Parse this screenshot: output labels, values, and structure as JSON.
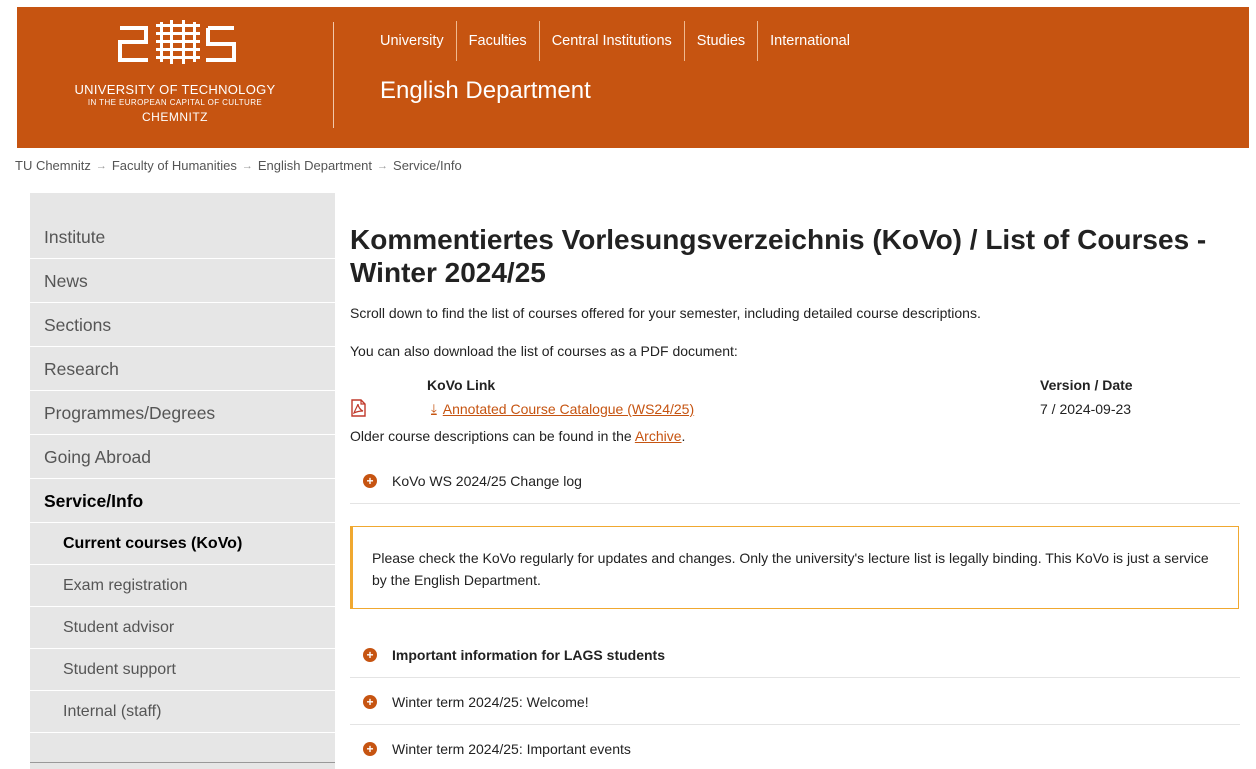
{
  "header": {
    "logo_line1": "UNIVERSITY OF TECHNOLOGY",
    "logo_line2": "IN THE EUROPEAN CAPITAL OF CULTURE",
    "logo_line3": "CHEMNITZ",
    "nav": [
      "University",
      "Faculties",
      "Central Institutions",
      "Studies",
      "International"
    ],
    "department": "English Department",
    "brand_color": "#c65411"
  },
  "breadcrumb": [
    "TU Chemnitz",
    "Faculty of Humanities",
    "English Department",
    "Service/Info"
  ],
  "sidebar": {
    "items": [
      "Institute",
      "News",
      "Sections",
      "Research",
      "Programmes/Degrees",
      "Going Abroad",
      "Service/Info"
    ],
    "active": "Service/Info",
    "subitems": [
      "Current courses (KoVo)",
      "Exam registration",
      "Student advisor",
      "Student support",
      "Internal (staff)"
    ],
    "current": "Current courses (KoVo)"
  },
  "main": {
    "title": "Kommentiertes Vorlesungsverzeichnis (KoVo) / List of Courses - Winter 2024/25",
    "intro1": "Scroll down to find the list of courses offered for your semester, including detailed course descriptions.",
    "intro2": "You can also download the list of courses as a PDF document:",
    "table": {
      "col_link": "KoVo Link",
      "col_version": "Version / Date",
      "link_text": "Annotated Course Catalogue (WS24/25)",
      "version": "7 / 2024-09-23"
    },
    "older_prefix": "Older course descriptions can be found in the ",
    "archive_link": "Archive",
    "older_suffix": ".",
    "changelog": "KoVo WS 2024/25 Change log",
    "notice": "Please check the KoVo regularly for updates and changes. Only the university's lecture list is legally binding. This KoVo is just a service by the English Department.",
    "accordions": [
      "Important information for LAGS students",
      "Winter term 2024/25: Welcome!",
      "Winter term 2024/25: Important events"
    ]
  }
}
